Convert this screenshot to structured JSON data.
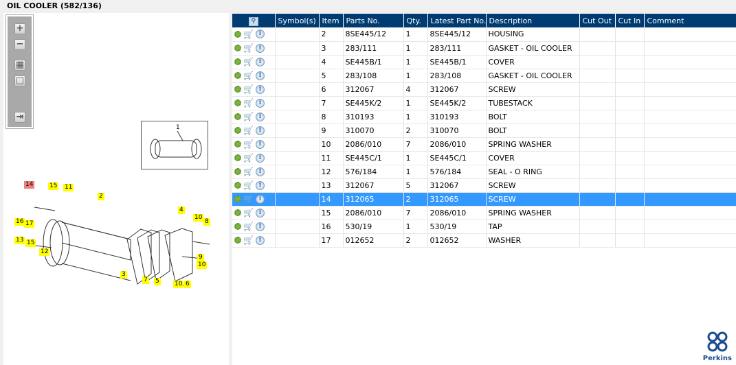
{
  "title": "OIL COOLER (582/136)",
  "toolbar": {
    "zoom_in": "+",
    "zoom_out": "−",
    "fit": "▦",
    "actual": "□",
    "toggle": "⇥"
  },
  "inset_label": "1",
  "callouts": [
    {
      "t": "14",
      "red": true
    },
    {
      "t": "15"
    },
    {
      "t": "11"
    },
    {
      "t": "2"
    },
    {
      "t": "16"
    },
    {
      "t": "17"
    },
    {
      "t": "13"
    },
    {
      "t": "15"
    },
    {
      "t": "12"
    },
    {
      "t": "4"
    },
    {
      "t": "10"
    },
    {
      "t": "8"
    },
    {
      "t": "9"
    },
    {
      "t": "10"
    },
    {
      "t": "3"
    },
    {
      "t": "7"
    },
    {
      "t": "5"
    },
    {
      "t": "10"
    },
    {
      "t": "6"
    }
  ],
  "columns": [
    "",
    "Symbol(s)",
    "Item",
    "Parts No.",
    "Qty.",
    "Latest Part No.",
    "Description",
    "Cut Out",
    "Cut In",
    "Comment"
  ],
  "rows": [
    [
      "2",
      "8SE445/12",
      "1",
      "8SE445/12",
      "HOUSING"
    ],
    [
      "3",
      "283/111",
      "1",
      "283/111",
      "GASKET - OIL COOLER"
    ],
    [
      "4",
      "SE445B/1",
      "1",
      "SE445B/1",
      "COVER"
    ],
    [
      "5",
      "283/108",
      "1",
      "283/108",
      "GASKET - OIL COOLER"
    ],
    [
      "6",
      "312067",
      "4",
      "312067",
      "SCREW"
    ],
    [
      "7",
      "SE445K/2",
      "1",
      "SE445K/2",
      "TUBESTACK"
    ],
    [
      "8",
      "310193",
      "1",
      "310193",
      "BOLT"
    ],
    [
      "9",
      "310070",
      "2",
      "310070",
      "BOLT"
    ],
    [
      "10",
      "2086/010",
      "7",
      "2086/010",
      "SPRING WASHER"
    ],
    [
      "11",
      "SE445C/1",
      "1",
      "SE445C/1",
      "COVER"
    ],
    [
      "12",
      "576/184",
      "1",
      "576/184",
      "SEAL - O RING"
    ],
    [
      "13",
      "312067",
      "5",
      "312067",
      "SCREW"
    ],
    [
      "14",
      "312065",
      "2",
      "312065",
      "SCREW"
    ],
    [
      "15",
      "2086/010",
      "7",
      "2086/010",
      "SPRING WASHER"
    ],
    [
      "16",
      "530/19",
      "1",
      "530/19",
      "TAP"
    ],
    [
      "17",
      "012652",
      "2",
      "012652",
      "WASHER"
    ]
  ],
  "selected_item": "14",
  "logo": "Perkins"
}
